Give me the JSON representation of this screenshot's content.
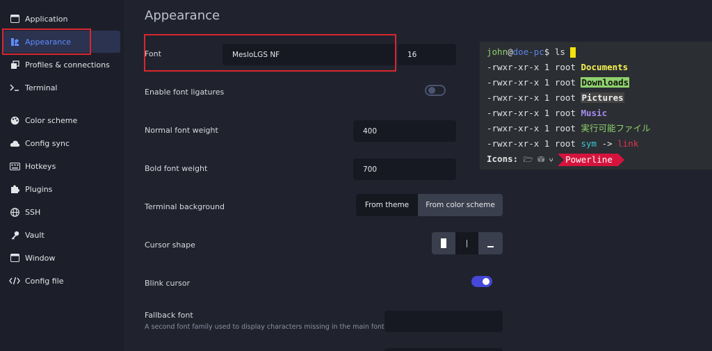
{
  "sidebar": {
    "items": [
      {
        "label": "Application",
        "icon": "window-icon"
      },
      {
        "label": "Appearance",
        "icon": "palette-icon"
      },
      {
        "label": "Profiles & connections",
        "icon": "stack-icon"
      },
      {
        "label": "Terminal",
        "icon": "terminal-icon"
      },
      {
        "label": "Color scheme",
        "icon": "palette-icon"
      },
      {
        "label": "Config sync",
        "icon": "cloud-icon"
      },
      {
        "label": "Hotkeys",
        "icon": "keyboard-icon"
      },
      {
        "label": "Plugins",
        "icon": "puzzle-icon"
      },
      {
        "label": "SSH",
        "icon": "globe-icon"
      },
      {
        "label": "Vault",
        "icon": "key-icon"
      },
      {
        "label": "Window",
        "icon": "window-icon"
      },
      {
        "label": "Config file",
        "icon": "code-icon"
      }
    ],
    "active": "Appearance"
  },
  "main": {
    "title": "Appearance",
    "font": {
      "label": "Font",
      "family": "MesloLGS NF",
      "size": "16"
    },
    "ligatures": {
      "label": "Enable font ligatures",
      "enabled": false
    },
    "normal_weight": {
      "label": "Normal font weight",
      "value": "400"
    },
    "bold_weight": {
      "label": "Bold font weight",
      "value": "700"
    },
    "background": {
      "label": "Terminal background",
      "options": [
        "From theme",
        "From color scheme"
      ],
      "selected": "From color scheme"
    },
    "cursor_shape": {
      "label": "Cursor shape",
      "options": [
        "█",
        "|",
        "_"
      ],
      "selected": "█"
    },
    "blink": {
      "label": "Blink cursor",
      "enabled": true
    },
    "fallback": {
      "label": "Fallback font",
      "description": "A second font family used to display characters missing in the main font",
      "value": ""
    }
  },
  "terminal_preview": {
    "user": "john",
    "at": "@",
    "host": "doe-pc",
    "prompt": "$",
    "command": " ls",
    "perm": "-rwxr-xr-x 1 root ",
    "entries": [
      "Documents",
      "Downloads",
      "Pictures",
      "Music",
      "実行可能ファイル",
      "sym"
    ],
    "arrow": " -> ",
    "link": "link",
    "icons_label": "Icons: ",
    "icons_glyphs": "🗁 ⛁ ⑂ ",
    "powerline": "Powerline"
  },
  "colors": {
    "accent": "#5e8cff",
    "highlight_box": "#d9262f",
    "toggle_on": "#4548d8"
  }
}
